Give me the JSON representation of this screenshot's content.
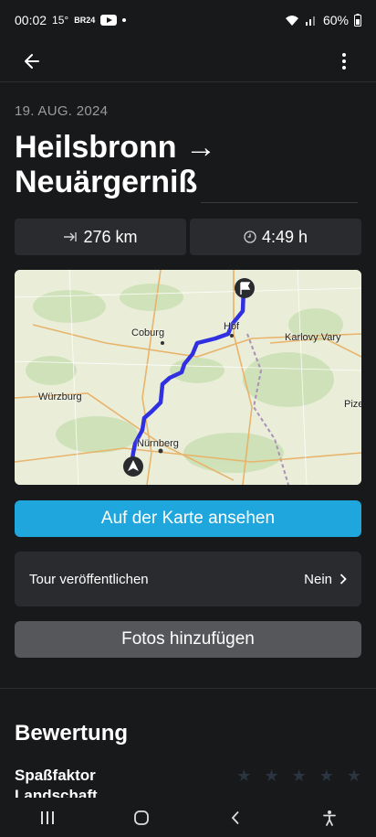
{
  "status": {
    "time": "00:02",
    "temp": "15°",
    "br_label": "BR24",
    "battery": "60%"
  },
  "app_bar": {
    "back_icon": "arrow-left-icon",
    "more_icon": "more-vert-icon"
  },
  "tour": {
    "date": "19. AUG. 2024",
    "title": "Heilsbronn → Neuärgerniß",
    "distance": "276 km",
    "duration": "4:49 h",
    "distance_icon": "arrow-to-line-icon",
    "duration_icon": "clock-icon"
  },
  "map": {
    "cities": [
      "Coburg",
      "Hof",
      "Karlovy Vary",
      "Würzburg",
      "Nürnberg",
      "Pize"
    ],
    "route_color": "#3030e0",
    "start_icon": "navigation-arrow-icon",
    "end_icon": "flag-icon"
  },
  "actions": {
    "view_on_map": "Auf der Karte ansehen",
    "publish_label": "Tour veröffentlichen",
    "publish_value": "Nein",
    "add_photos": "Fotos hinzufügen"
  },
  "rating": {
    "section_title": "Bewertung",
    "fun_label": "Spaßfaktor",
    "fun_stars": 0,
    "landscape_label": "Landschaft"
  },
  "colors": {
    "accent": "#1fa6dc",
    "background": "#18191b",
    "card": "#2a2b2e"
  }
}
